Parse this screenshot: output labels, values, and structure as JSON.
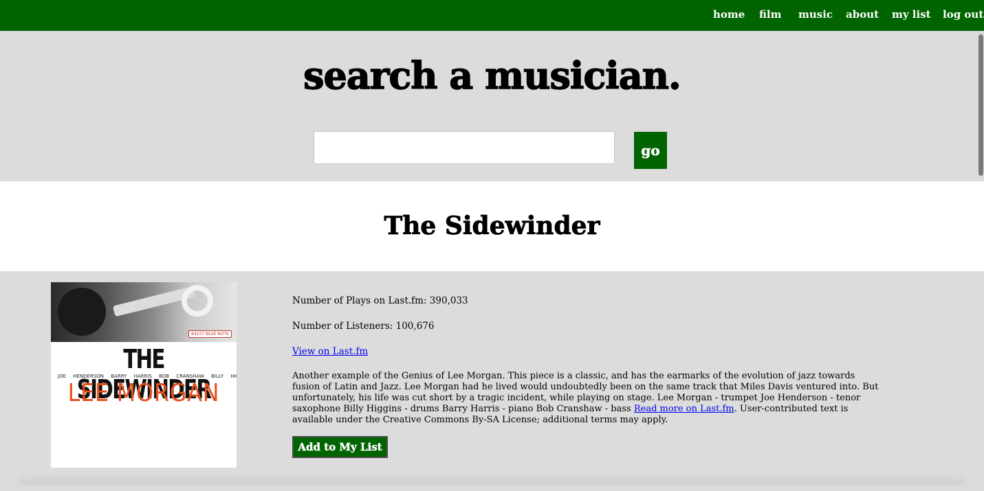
{
  "nav": {
    "items": [
      "home",
      "film",
      "music",
      "about",
      "my list",
      "log out"
    ],
    "color": "#006400"
  },
  "search": {
    "title": "search a musician.",
    "input_value": "",
    "go_label": "go"
  },
  "track": {
    "title": "The Sidewinder",
    "plays_text": "Number of Plays on Last.fm: 390,033",
    "listeners_text": "Number of Listeners: 100,676",
    "view_link": "View on Last.fm",
    "summary_text": "Another example of the Genius of Lee Morgan. This piece is a classic, and has the earmarks of the evolution of jazz towards fusion of Latin and Jazz. Lee Morgan had he lived would undoubtedly been on the same track that Miles Davis ventured into. But unfortunately, his life was cut short by a tragic incident, while playing on stage. Lee Morgan - trumpet Joe Henderson - tenor saxophone Billy Higgins - drums Barry Harris - piano Bob Cranshaw - bass ",
    "read_more_link": "Read more on Last.fm",
    "license_text": ". User-contributed text is available under the Creative Commons By-SA License; additional terms may apply.",
    "add_button": "Add to My List"
  },
  "album_art": {
    "title": "THE SIDEWINDER",
    "sidemen": "JOE HENDERSON   BARRY HARRIS   BOB CRANSHAW   BILLY HIGGINS",
    "leader": "LEE MORGAN",
    "label": "84157 BLUE NOTE",
    "accent_color": "#e6501c"
  }
}
